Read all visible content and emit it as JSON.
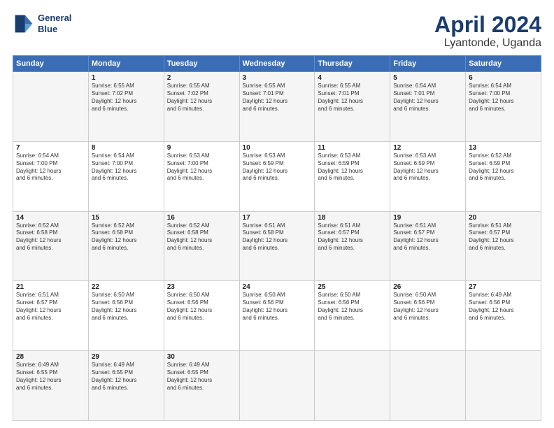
{
  "header": {
    "logo_line1": "General",
    "logo_line2": "Blue",
    "title": "April 2024",
    "subtitle": "Lyantonde, Uganda"
  },
  "columns": [
    "Sunday",
    "Monday",
    "Tuesday",
    "Wednesday",
    "Thursday",
    "Friday",
    "Saturday"
  ],
  "weeks": [
    [
      {
        "day": "",
        "info": ""
      },
      {
        "day": "1",
        "info": "Sunrise: 6:55 AM\nSunset: 7:02 PM\nDaylight: 12 hours\nand 6 minutes."
      },
      {
        "day": "2",
        "info": "Sunrise: 6:55 AM\nSunset: 7:02 PM\nDaylight: 12 hours\nand 6 minutes."
      },
      {
        "day": "3",
        "info": "Sunrise: 6:55 AM\nSunset: 7:01 PM\nDaylight: 12 hours\nand 6 minutes."
      },
      {
        "day": "4",
        "info": "Sunrise: 6:55 AM\nSunset: 7:01 PM\nDaylight: 12 hours\nand 6 minutes."
      },
      {
        "day": "5",
        "info": "Sunrise: 6:54 AM\nSunset: 7:01 PM\nDaylight: 12 hours\nand 6 minutes."
      },
      {
        "day": "6",
        "info": "Sunrise: 6:54 AM\nSunset: 7:00 PM\nDaylight: 12 hours\nand 6 minutes."
      }
    ],
    [
      {
        "day": "7",
        "info": "Sunrise: 6:54 AM\nSunset: 7:00 PM\nDaylight: 12 hours\nand 6 minutes."
      },
      {
        "day": "8",
        "info": "Sunrise: 6:54 AM\nSunset: 7:00 PM\nDaylight: 12 hours\nand 6 minutes."
      },
      {
        "day": "9",
        "info": "Sunrise: 6:53 AM\nSunset: 7:00 PM\nDaylight: 12 hours\nand 6 minutes."
      },
      {
        "day": "10",
        "info": "Sunrise: 6:53 AM\nSunset: 6:59 PM\nDaylight: 12 hours\nand 6 minutes."
      },
      {
        "day": "11",
        "info": "Sunrise: 6:53 AM\nSunset: 6:59 PM\nDaylight: 12 hours\nand 6 minutes."
      },
      {
        "day": "12",
        "info": "Sunrise: 6:53 AM\nSunset: 6:59 PM\nDaylight: 12 hours\nand 6 minutes."
      },
      {
        "day": "13",
        "info": "Sunrise: 6:52 AM\nSunset: 6:59 PM\nDaylight: 12 hours\nand 6 minutes."
      }
    ],
    [
      {
        "day": "14",
        "info": "Sunrise: 6:52 AM\nSunset: 6:58 PM\nDaylight: 12 hours\nand 6 minutes."
      },
      {
        "day": "15",
        "info": "Sunrise: 6:52 AM\nSunset: 6:58 PM\nDaylight: 12 hours\nand 6 minutes."
      },
      {
        "day": "16",
        "info": "Sunrise: 6:52 AM\nSunset: 6:58 PM\nDaylight: 12 hours\nand 6 minutes."
      },
      {
        "day": "17",
        "info": "Sunrise: 6:51 AM\nSunset: 6:58 PM\nDaylight: 12 hours\nand 6 minutes."
      },
      {
        "day": "18",
        "info": "Sunrise: 6:51 AM\nSunset: 6:57 PM\nDaylight: 12 hours\nand 6 minutes."
      },
      {
        "day": "19",
        "info": "Sunrise: 6:51 AM\nSunset: 6:57 PM\nDaylight: 12 hours\nand 6 minutes."
      },
      {
        "day": "20",
        "info": "Sunrise: 6:51 AM\nSunset: 6:57 PM\nDaylight: 12 hours\nand 6 minutes."
      }
    ],
    [
      {
        "day": "21",
        "info": "Sunrise: 6:51 AM\nSunset: 6:57 PM\nDaylight: 12 hours\nand 6 minutes."
      },
      {
        "day": "22",
        "info": "Sunrise: 6:50 AM\nSunset: 6:56 PM\nDaylight: 12 hours\nand 6 minutes."
      },
      {
        "day": "23",
        "info": "Sunrise: 6:50 AM\nSunset: 6:56 PM\nDaylight: 12 hours\nand 6 minutes."
      },
      {
        "day": "24",
        "info": "Sunrise: 6:50 AM\nSunset: 6:56 PM\nDaylight: 12 hours\nand 6 minutes."
      },
      {
        "day": "25",
        "info": "Sunrise: 6:50 AM\nSunset: 6:56 PM\nDaylight: 12 hours\nand 6 minutes."
      },
      {
        "day": "26",
        "info": "Sunrise: 6:50 AM\nSunset: 6:56 PM\nDaylight: 12 hours\nand 6 minutes."
      },
      {
        "day": "27",
        "info": "Sunrise: 6:49 AM\nSunset: 6:56 PM\nDaylight: 12 hours\nand 6 minutes."
      }
    ],
    [
      {
        "day": "28",
        "info": "Sunrise: 6:49 AM\nSunset: 6:55 PM\nDaylight: 12 hours\nand 6 minutes."
      },
      {
        "day": "29",
        "info": "Sunrise: 6:49 AM\nSunset: 6:55 PM\nDaylight: 12 hours\nand 6 minutes."
      },
      {
        "day": "30",
        "info": "Sunrise: 6:49 AM\nSunset: 6:55 PM\nDaylight: 12 hours\nand 6 minutes."
      },
      {
        "day": "",
        "info": ""
      },
      {
        "day": "",
        "info": ""
      },
      {
        "day": "",
        "info": ""
      },
      {
        "day": "",
        "info": ""
      }
    ]
  ]
}
